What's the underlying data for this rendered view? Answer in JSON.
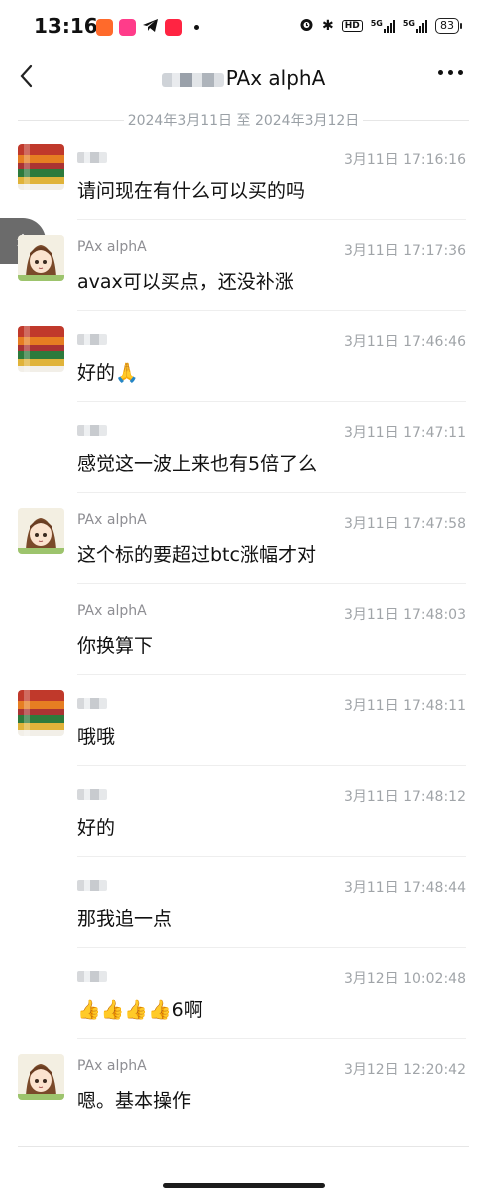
{
  "status": {
    "time": "13:16",
    "battery": "83",
    "network": "5G"
  },
  "header": {
    "title": "PAx alphA"
  },
  "date_range": "2024年3月11日 至 2024年3月12日",
  "messages": [
    {
      "sender": "",
      "time": "3月11日 17:16:16",
      "text": "请问现在有什么可以买的吗"
    },
    {
      "sender": "PAx alphA",
      "time": "3月11日 17:17:36",
      "text": "avax可以买点，还没补涨"
    },
    {
      "sender": "",
      "time": "3月11日 17:46:46",
      "text": "好的🙏"
    },
    {
      "sender": "",
      "time": "3月11日 17:47:11",
      "text": "感觉这一波上来也有5倍了么"
    },
    {
      "sender": "PAx alphA",
      "time": "3月11日 17:47:58",
      "text": "这个标的要超过btc涨幅才对"
    },
    {
      "sender": "PAx alphA",
      "time": "3月11日 17:48:03",
      "text": "你换算下"
    },
    {
      "sender": "",
      "time": "3月11日 17:48:11",
      "text": "哦哦"
    },
    {
      "sender": "",
      "time": "3月11日 17:48:12",
      "text": "好的"
    },
    {
      "sender": "",
      "time": "3月11日 17:48:44",
      "text": "那我追一点"
    },
    {
      "sender": "",
      "time": "3月12日 10:02:48",
      "text": "👍👍👍👍6啊"
    },
    {
      "sender": "PAx alphA",
      "time": "3月12日 12:20:42",
      "text": "嗯。基本操作"
    }
  ]
}
